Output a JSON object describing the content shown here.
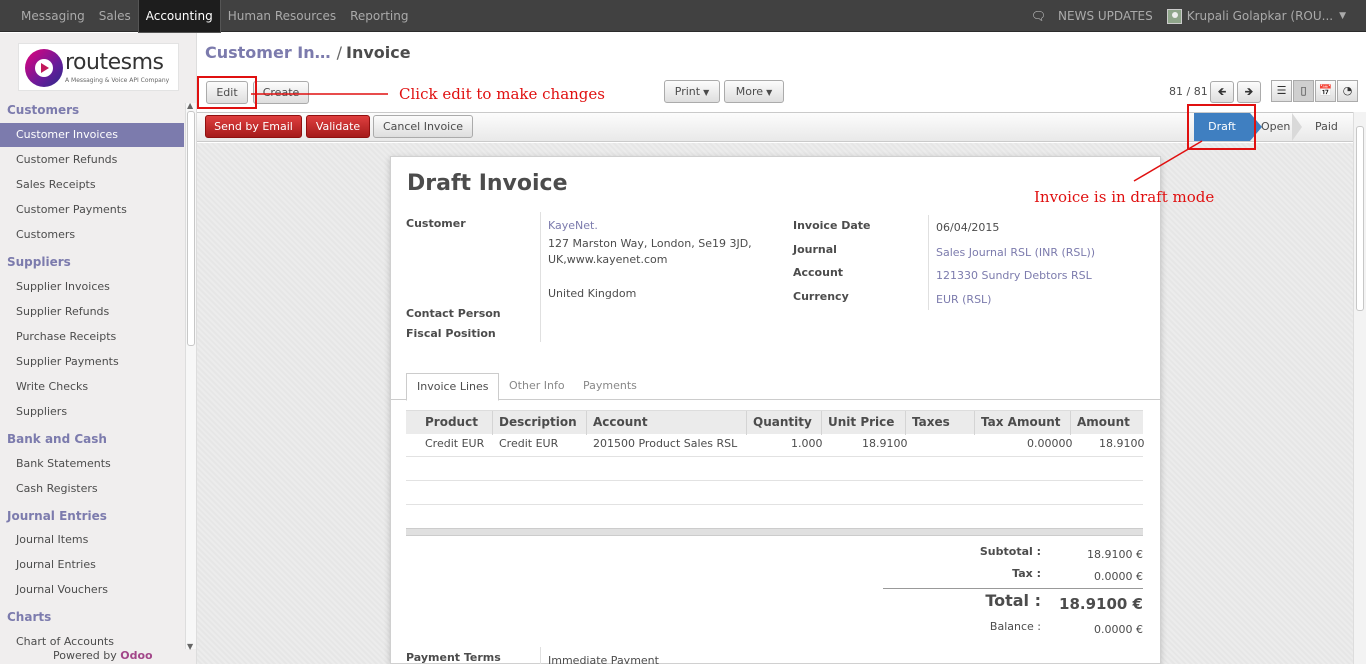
{
  "topbar": {
    "menu": [
      "Messaging",
      "Sales",
      "Accounting",
      "Human Resources",
      "Reporting"
    ],
    "news": "NEWS UPDATES",
    "user": "Krupali Golapkar (ROU..."
  },
  "logo": {
    "name": "routesms",
    "tagline": "A Messaging & Voice API Company"
  },
  "sidebar": {
    "groups": [
      {
        "title": "Customers",
        "items": [
          "Customer Invoices",
          "Customer Refunds",
          "Sales Receipts",
          "Customer Payments",
          "Customers"
        ]
      },
      {
        "title": "Suppliers",
        "items": [
          "Supplier Invoices",
          "Supplier Refunds",
          "Purchase Receipts",
          "Supplier Payments",
          "Write Checks",
          "Suppliers"
        ]
      },
      {
        "title": "Bank and Cash",
        "items": [
          "Bank Statements",
          "Cash Registers"
        ]
      },
      {
        "title": "Journal Entries",
        "items": [
          "Journal Items",
          "Journal Entries",
          "Journal Vouchers"
        ]
      },
      {
        "title": "Charts",
        "items": [
          "Chart of Accounts"
        ]
      }
    ],
    "powered_prefix": "Powered by",
    "powered_brand": "Odoo"
  },
  "breadcrumb": {
    "parent": "Customer In…",
    "separator": "/",
    "current": "Invoice"
  },
  "toolbar": {
    "edit": "Edit",
    "create": "Create",
    "print": "Print",
    "more": "More",
    "pager": "81 / 81"
  },
  "actions": {
    "send_email": "Send by Email",
    "validate": "Validate",
    "cancel": "Cancel Invoice"
  },
  "states": {
    "draft": "Draft",
    "open": "Open",
    "paid": "Paid"
  },
  "invoice": {
    "title": "Draft Invoice",
    "customer_label": "Customer",
    "customer_name": "KayeNet.",
    "customer_addr1": "127 Marston Way, London, Se19 3JD,",
    "customer_addr2": "UK,www.kayenet.com",
    "customer_country": "United Kingdom",
    "contact_label": "Contact Person",
    "fiscal_label": "Fiscal Position",
    "date_label": "Invoice Date",
    "date_value": "06/04/2015",
    "journal_label": "Journal",
    "journal_value": "Sales Journal RSL (INR (RSL))",
    "account_label": "Account",
    "account_value": "121330 Sundry Debtors RSL",
    "currency_label": "Currency",
    "currency_value": "EUR (RSL)",
    "payment_terms_label": "Payment Terms",
    "payment_terms_value": "Immediate Payment"
  },
  "tabs": [
    "Invoice Lines",
    "Other Info",
    "Payments"
  ],
  "lines": {
    "columns": [
      "Product",
      "Description",
      "Account",
      "Quantity",
      "Unit Price",
      "Taxes",
      "Tax Amount",
      "Amount"
    ],
    "rows": [
      {
        "product": "Credit EUR",
        "description": "Credit EUR",
        "account": "201500 Product Sales RSL",
        "quantity": "1.000",
        "unit_price": "18.9100",
        "taxes": "",
        "tax_amount": "0.00000",
        "amount": "18.9100"
      }
    ]
  },
  "totals": {
    "subtotal_label": "Subtotal :",
    "subtotal": "18.9100 €",
    "tax_label": "Tax :",
    "tax": "0.0000 €",
    "total_label": "Total :",
    "total": "18.9100 €",
    "balance_label": "Balance :",
    "balance": "0.0000 €"
  },
  "annotations": {
    "edit_note": "Click edit to make changes",
    "draft_note": "Invoice is in draft mode",
    "color": "#e01010"
  },
  "colors": {
    "accent": "#7c7bad",
    "draft": "#3f7fc1",
    "danger": "#c12a2a",
    "brand": "#a24689"
  }
}
